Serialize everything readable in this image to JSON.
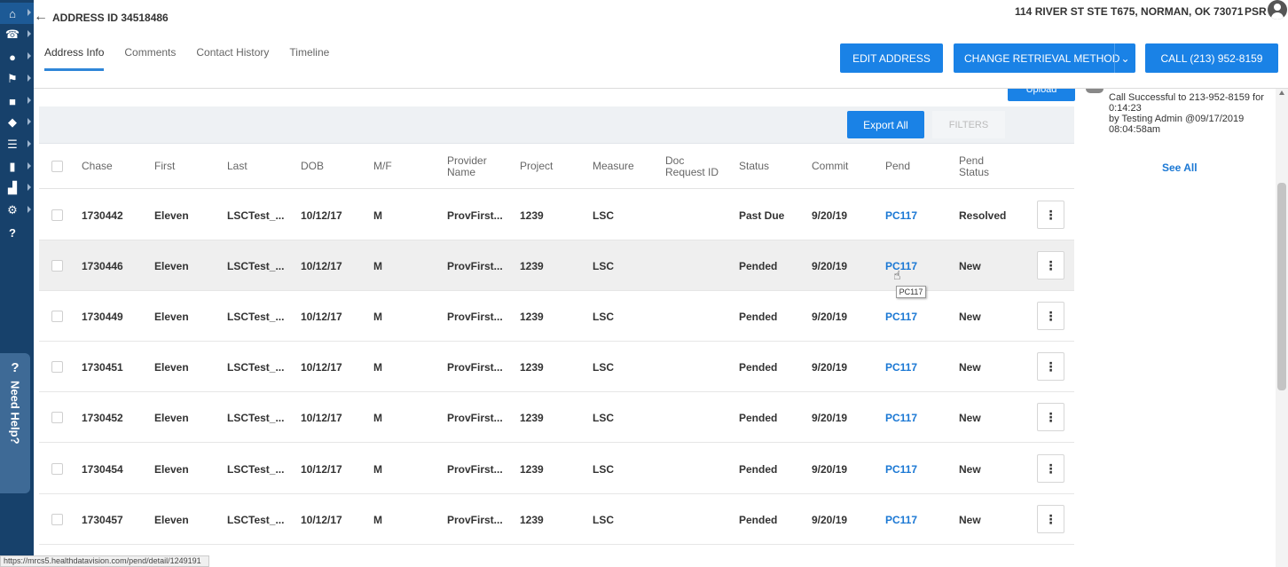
{
  "header": {
    "address_id": "ADDRESS ID 34518486",
    "address_line": "114 RIVER ST STE T675, NORMAN, OK 73071",
    "user": "PSR"
  },
  "tabs": [
    {
      "label": "Address Info",
      "active": true
    },
    {
      "label": "Comments",
      "active": false
    },
    {
      "label": "Contact History",
      "active": false
    },
    {
      "label": "Timeline",
      "active": false
    }
  ],
  "actions": {
    "edit_address": "EDIT ADDRESS",
    "change_retrieval": "CHANGE RETRIEVAL METHOD",
    "call": "CALL (213) 952-8159"
  },
  "toolbar": {
    "upload": "Upload",
    "export_all": "Export All",
    "filters": "FILTERS"
  },
  "table": {
    "columns": [
      "Chase",
      "First",
      "Last",
      "DOB",
      "M/F",
      "Provider Name",
      "Project",
      "Measure",
      "Doc Request ID",
      "Status",
      "Commit",
      "Pend",
      "Pend Status"
    ],
    "rows": [
      [
        "1730442",
        "Eleven",
        "LSCTest_...",
        "10/12/17",
        "M",
        "ProvFirst...",
        "1239",
        "LSC",
        "",
        "Past Due",
        "9/20/19",
        "PC117",
        "Resolved"
      ],
      [
        "1730446",
        "Eleven",
        "LSCTest_...",
        "10/12/17",
        "M",
        "ProvFirst...",
        "1239",
        "LSC",
        "",
        "Pended",
        "9/20/19",
        "PC117",
        "New"
      ],
      [
        "1730449",
        "Eleven",
        "LSCTest_...",
        "10/12/17",
        "M",
        "ProvFirst...",
        "1239",
        "LSC",
        "",
        "Pended",
        "9/20/19",
        "PC117",
        "New"
      ],
      [
        "1730451",
        "Eleven",
        "LSCTest_...",
        "10/12/17",
        "M",
        "ProvFirst...",
        "1239",
        "LSC",
        "",
        "Pended",
        "9/20/19",
        "PC117",
        "New"
      ],
      [
        "1730452",
        "Eleven",
        "LSCTest_...",
        "10/12/17",
        "M",
        "ProvFirst...",
        "1239",
        "LSC",
        "",
        "Pended",
        "9/20/19",
        "PC117",
        "New"
      ],
      [
        "1730454",
        "Eleven",
        "LSCTest_...",
        "10/12/17",
        "M",
        "ProvFirst...",
        "1239",
        "LSC",
        "",
        "Pended",
        "9/20/19",
        "PC117",
        "New"
      ],
      [
        "1730457",
        "Eleven",
        "LSCTest_...",
        "10/12/17",
        "M",
        "ProvFirst...",
        "1239",
        "LSC",
        "",
        "Pended",
        "9/20/19",
        "PC117",
        "New"
      ]
    ],
    "tooltip": "PC117"
  },
  "call_log": {
    "line1": "Call Successful to 213-952-8159 for 0:14:23",
    "line2": "by Testing Admin @09/17/2019 08:04:58am",
    "see_all": "See All"
  },
  "need_help": {
    "q": "?",
    "label": "Need Help?"
  },
  "status_url": "https://mrcs5.healthdatavision.com/pend/detail/1249191",
  "sidebar_icons": [
    "home-icon",
    "phone-icon",
    "users-icon",
    "flag-icon",
    "briefcase-icon",
    "layers-icon",
    "list-icon",
    "clipboard-icon",
    "chart-icon",
    "gear-icon",
    "help-icon"
  ],
  "colors": {
    "sidebar": "#17416b",
    "primary": "#1a82e6",
    "link": "#1b78d4"
  }
}
